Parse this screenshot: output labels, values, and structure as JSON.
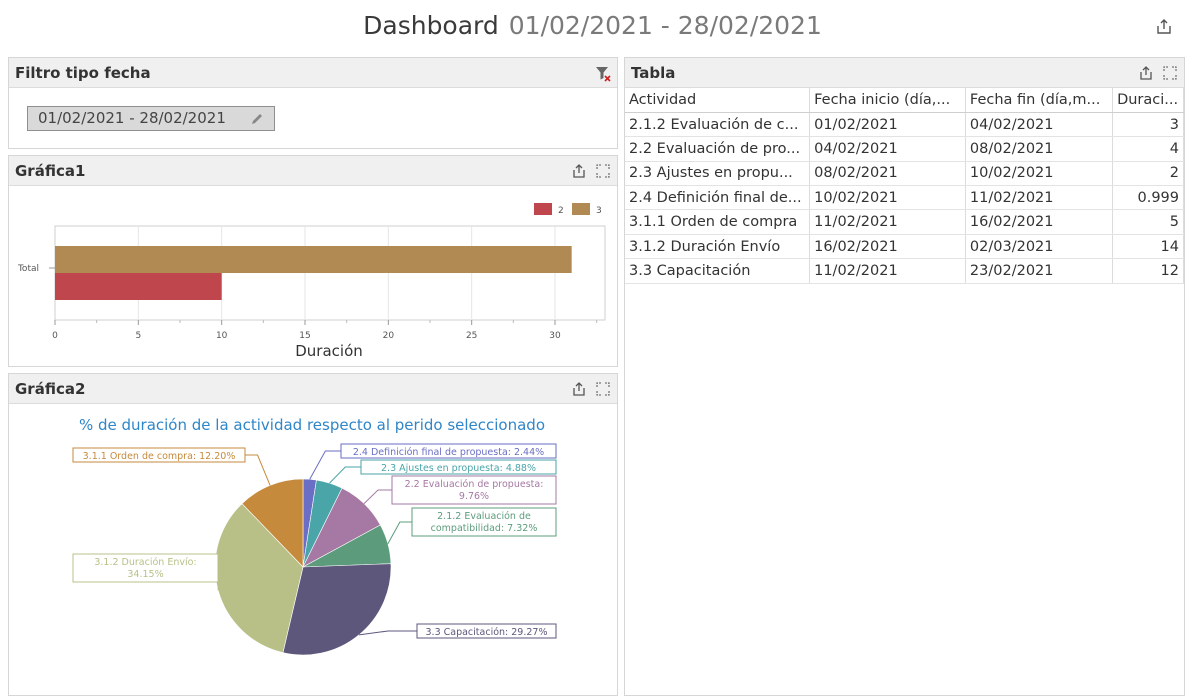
{
  "header": {
    "title": "Dashboard",
    "date_range": "01/02/2021 - 28/02/2021"
  },
  "filter_panel": {
    "title": "Filtro tipo fecha",
    "chip_value": "01/02/2021 - 28/02/2021"
  },
  "grafica1": {
    "title": "Gráfica1",
    "legend": [
      {
        "label": "2",
        "color": "#c0464e"
      },
      {
        "label": "3",
        "color": "#b08a52"
      }
    ],
    "category_label": "Total",
    "x_ticks": [
      "0",
      "5",
      "10",
      "15",
      "20",
      "25",
      "30"
    ],
    "x_label": "Duración"
  },
  "grafica2": {
    "title": "Gráfica2",
    "chart_title": "% de duración de la actividad respecto al perido seleccionado"
  },
  "tabla": {
    "title": "Tabla",
    "columns": [
      "Actividad",
      "Fecha inicio (día,...",
      "Fecha fin (día,m...",
      "Duraci..."
    ],
    "rows": [
      [
        "2.1.2 Evaluación de c...",
        "01/02/2021",
        "04/02/2021",
        "3"
      ],
      [
        "2.2 Evaluación de pro...",
        "04/02/2021",
        "08/02/2021",
        "4"
      ],
      [
        "2.3 Ajustes en propu...",
        "08/02/2021",
        "10/02/2021",
        "2"
      ],
      [
        "2.4 Definición final de...",
        "10/02/2021",
        "11/02/2021",
        "0.999"
      ],
      [
        "3.1.1 Orden de compra",
        "11/02/2021",
        "16/02/2021",
        "5"
      ],
      [
        "3.1.2 Duración Envío",
        "16/02/2021",
        "02/03/2021",
        "14"
      ],
      [
        "3.3 Capacitación",
        "11/02/2021",
        "23/02/2021",
        "12"
      ]
    ]
  },
  "chart_data": [
    {
      "type": "bar",
      "orientation": "horizontal",
      "categories": [
        "Total"
      ],
      "series": [
        {
          "name": "2",
          "values": [
            10
          ],
          "color": "#c0464e"
        },
        {
          "name": "3",
          "values": [
            31
          ],
          "color": "#b08a52"
        }
      ],
      "xlabel": "Duración",
      "xlim": [
        0,
        33
      ],
      "x_ticks": [
        0,
        5,
        10,
        15,
        20,
        25,
        30
      ],
      "grid": true,
      "legend": "top-right"
    },
    {
      "type": "pie",
      "title": "% de duración de la actividad respecto al perido seleccionado",
      "slices": [
        {
          "label": "2.4 Definición final de propuesta: 2.44%",
          "value": 2.44,
          "color": "#6a6ec4"
        },
        {
          "label": "2.3 Ajustes en propuesta: 4.88%",
          "value": 4.88,
          "color": "#4aa5a8"
        },
        {
          "label": "2.2 Evaluación de propuesta: 9.76%",
          "value": 9.76,
          "color": "#a679a4"
        },
        {
          "label": "2.1.2 Evaluación de compatibilidad: 7.32%",
          "value": 7.32,
          "color": "#5c9c7c"
        },
        {
          "label": "3.3 Capacitación: 29.27%",
          "value": 29.27,
          "color": "#5d577c"
        },
        {
          "label": "3.1.2 Duración Envío: 34.15%",
          "value": 34.15,
          "color": "#b8c088"
        },
        {
          "label": "3.1.1 Orden de compra: 12.20%",
          "value": 12.2,
          "color": "#c68a3c"
        }
      ]
    }
  ]
}
